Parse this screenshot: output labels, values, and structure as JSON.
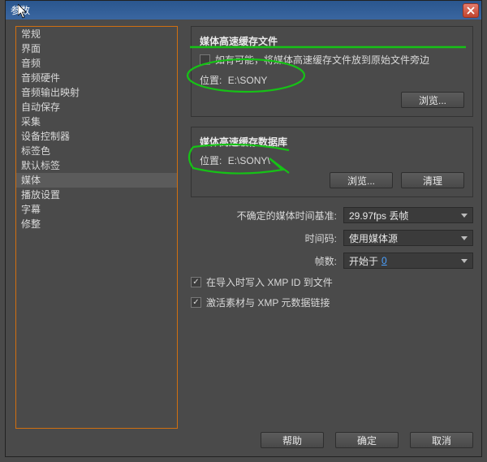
{
  "title": "参数",
  "sidebar": {
    "items": [
      {
        "label": "常规"
      },
      {
        "label": "界面"
      },
      {
        "label": "音频"
      },
      {
        "label": "音频硬件"
      },
      {
        "label": "音频输出映射"
      },
      {
        "label": "自动保存"
      },
      {
        "label": "采集"
      },
      {
        "label": "设备控制器"
      },
      {
        "label": "标签色"
      },
      {
        "label": "默认标签"
      },
      {
        "label": "媒体"
      },
      {
        "label": "播放设置"
      },
      {
        "label": "字幕"
      },
      {
        "label": "修整"
      }
    ],
    "selected_index": 10
  },
  "cache_files": {
    "title": "媒体高速缓存文件",
    "check_label": "如有可能，将媒体高速缓存文件放到原始文件旁边",
    "checked": false,
    "location_label": "位置:",
    "location_value": "E:\\SONY",
    "browse": "浏览..."
  },
  "cache_db": {
    "title": "媒体高速缓存数据库",
    "location_label": "位置:",
    "location_value": "E:\\SONY\\",
    "browse": "浏览...",
    "clean": "清理"
  },
  "timebase": {
    "label": "不确定的媒体时间基准:",
    "value": "29.97fps 丢帧"
  },
  "timecode": {
    "label": "时间码:",
    "value": "使用媒体源"
  },
  "frames": {
    "label": "帧数:",
    "prefix": "开始于",
    "value": "0"
  },
  "opts": {
    "xmp_id": {
      "label": "在导入时写入 XMP ID 到文件",
      "checked": true
    },
    "xmp_link": {
      "label": "激活素材与 XMP 元数据链接",
      "checked": true
    }
  },
  "footer": {
    "help": "帮助",
    "ok": "确定",
    "cancel": "取消"
  }
}
